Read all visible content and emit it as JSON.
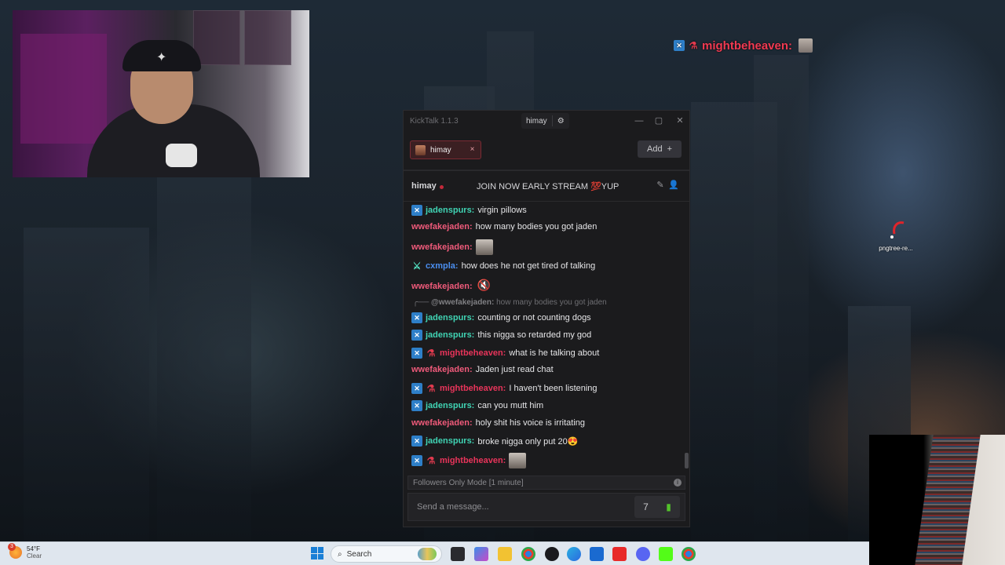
{
  "overlay": {
    "alert_username": "mightbeheaven:"
  },
  "desktop_icon": {
    "label": "pngtree-re..."
  },
  "window": {
    "app_title": "KickTalk 1.1.3",
    "current_user": "himay",
    "controls": {
      "minimize": "—",
      "maximize": "▢",
      "close": "✕"
    }
  },
  "tabs": [
    {
      "label": "himay",
      "close": "×"
    }
  ],
  "add_button": {
    "label": "Add",
    "icon": "+"
  },
  "chat_header": {
    "channel": "himay",
    "title": "JOIN NOW EARLY STREAM 💯YUP"
  },
  "messages": [
    {
      "user": "jadenspurs:",
      "color": "#40d4b4",
      "badges": [
        "blue"
      ],
      "text": "virgin pillows"
    },
    {
      "user": "wwefakejaden:",
      "color": "#ef5a7a",
      "badges": [],
      "text": "how many bodies you got jaden"
    },
    {
      "user": "wwefakejaden:",
      "color": "#ef5a7a",
      "badges": [],
      "text": "",
      "emote": "face"
    },
    {
      "user": "cxmpla:",
      "color": "#4b8eef",
      "badges": [
        "green"
      ],
      "text": "how does he not get tired of talking"
    },
    {
      "user": "wwefakejaden:",
      "color": "#ef5a7a",
      "badges": [],
      "text": "",
      "emote": "mute"
    },
    {
      "user": "jadenspurs:",
      "color": "#40d4b4",
      "badges": [
        "blue"
      ],
      "text": "counting or not counting dogs"
    },
    {
      "user": "jadenspurs:",
      "color": "#40d4b4",
      "badges": [
        "blue"
      ],
      "text": "this nigga so retarded my god"
    },
    {
      "user": "mightbeheaven:",
      "color": "#e8345a",
      "badges": [
        "blue",
        "red"
      ],
      "text": "what is he talking about"
    },
    {
      "user": "wwefakejaden:",
      "color": "#ef5a7a",
      "badges": [],
      "text": "Jaden just read chat"
    },
    {
      "user": "mightbeheaven:",
      "color": "#e8345a",
      "badges": [
        "blue",
        "red"
      ],
      "text": "I haven't been listening"
    },
    {
      "user": "jadenspurs:",
      "color": "#40d4b4",
      "badges": [
        "blue"
      ],
      "text": "can you mutt him"
    },
    {
      "user": "wwefakejaden:",
      "color": "#ef5a7a",
      "badges": [],
      "text": "holy shit his voice is irritating"
    },
    {
      "user": "jadenspurs:",
      "color": "#40d4b4",
      "badges": [
        "blue"
      ],
      "text": "broke nigga only put 20😍"
    },
    {
      "user": "mightbeheaven:",
      "color": "#e8345a",
      "badges": [
        "blue",
        "red"
      ],
      "text": "",
      "emote": "face"
    }
  ],
  "reply_context": {
    "mention": "@wwefakejaden:",
    "quoted": "how many bodies you got jaden"
  },
  "chat_mode": "Followers Only Mode [1 minute]",
  "chat_input": {
    "placeholder": "Send a message...",
    "value": ""
  },
  "taskbar": {
    "weather_temp": "54°F",
    "weather_condition": "Clear",
    "weather_badge": "3",
    "search_label": "Search"
  }
}
